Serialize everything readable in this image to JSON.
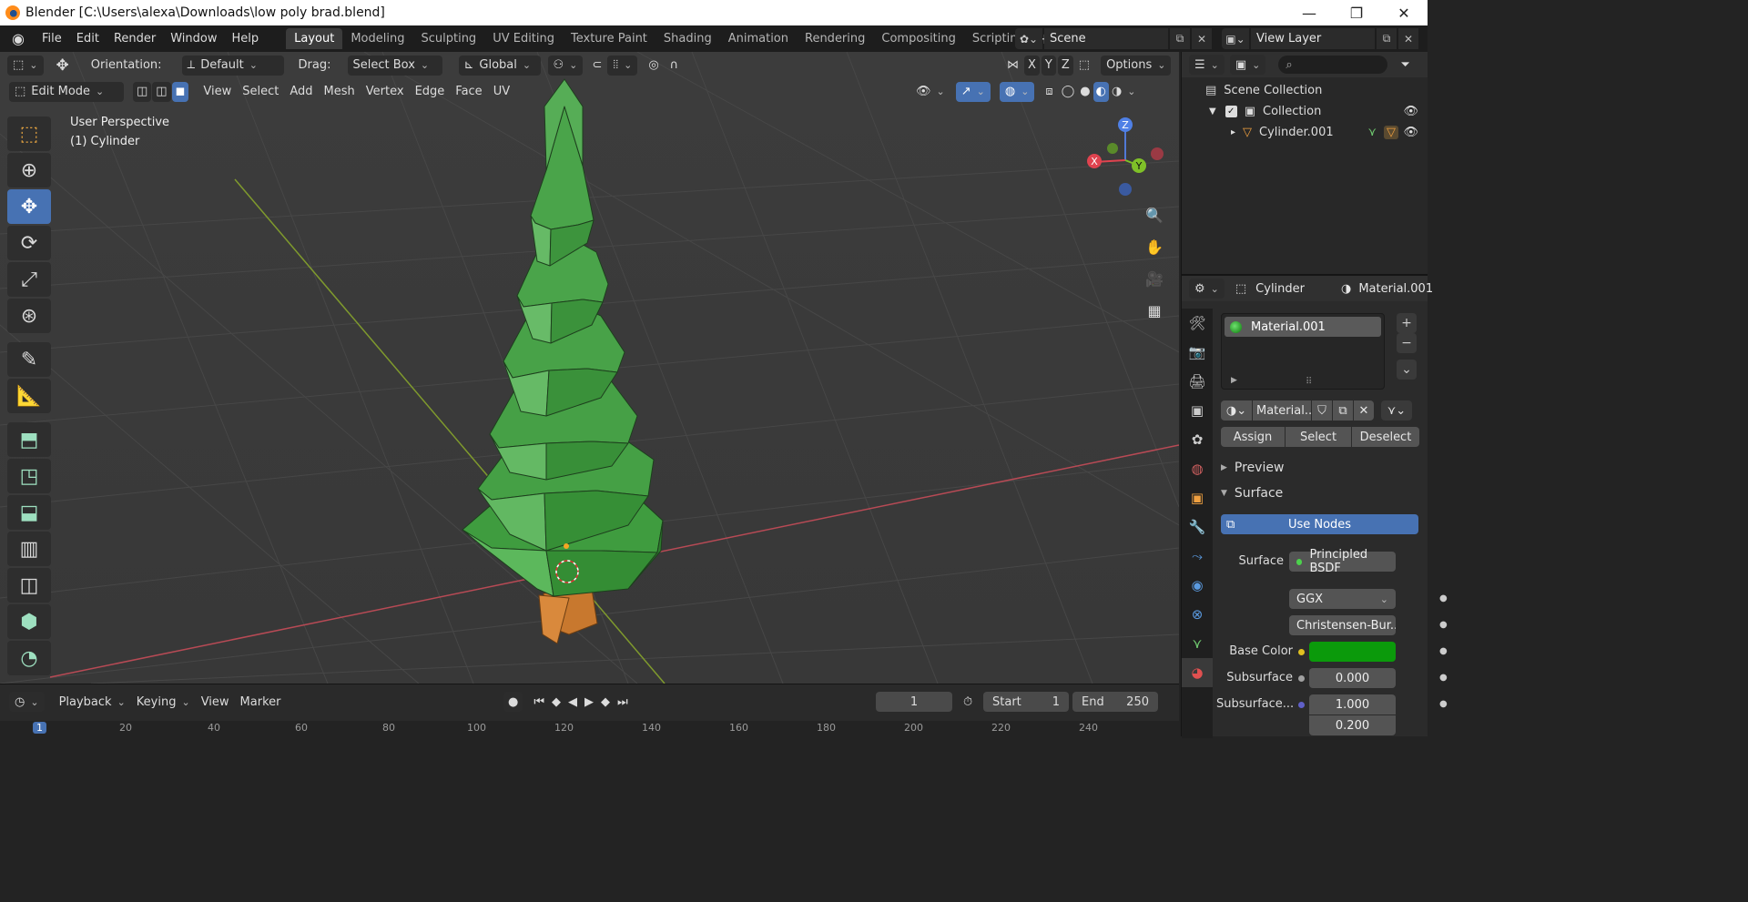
{
  "window": {
    "title": "Blender [C:\\Users\\alexa\\Downloads\\low poly brad.blend]",
    "controls": [
      "—",
      "❐",
      "✕"
    ]
  },
  "menubar": {
    "items": [
      "File",
      "Edit",
      "Render",
      "Window",
      "Help"
    ],
    "workspaces": [
      "Layout",
      "Modeling",
      "Sculpting",
      "UV Editing",
      "Texture Paint",
      "Shading",
      "Animation",
      "Rendering",
      "Compositing",
      "Scripting"
    ],
    "active_workspace": "Layout",
    "scene": "Scene",
    "view_layer": "View Layer"
  },
  "viewport_header": {
    "orientation_label": "Orientation:",
    "orientation_value": "Default",
    "drag_label": "Drag:",
    "drag_value": "Select Box",
    "transform_space": "Global",
    "axes": [
      "X",
      "Y",
      "Z"
    ],
    "options_label": "Options",
    "mode": "Edit Mode",
    "menus": [
      "View",
      "Select",
      "Add",
      "Mesh",
      "Vertex",
      "Edge",
      "Face",
      "UV"
    ]
  },
  "viewport": {
    "perspective_label": "User Perspective",
    "object_label": "(1) Cylinder",
    "gizmo_axes": [
      "X",
      "Y",
      "Z"
    ]
  },
  "timeline": {
    "menus": [
      "Playback",
      "Keying",
      "View",
      "Marker"
    ],
    "current_frame": "1",
    "start_label": "Start",
    "start_value": "1",
    "end_label": "End",
    "end_value": "250",
    "ruler_ticks": [
      "1",
      "20",
      "40",
      "60",
      "80",
      "100",
      "120",
      "140",
      "160",
      "180",
      "200",
      "220",
      "240"
    ]
  },
  "outliner": {
    "rows": [
      {
        "label": "Scene Collection"
      },
      {
        "label": "Collection"
      },
      {
        "label": "Cylinder.001"
      }
    ]
  },
  "properties": {
    "object_name": "Cylinder",
    "material_name": "Material.001",
    "slots": [
      "Material.001"
    ],
    "material_field": "Material...",
    "buttons": [
      "Assign",
      "Select",
      "Deselect"
    ],
    "panels": {
      "preview": "Preview",
      "surface": "Surface"
    },
    "use_nodes": "Use Nodes",
    "surface_label": "Surface",
    "surface_value": "Principled BSDF",
    "distribution": "GGX",
    "subsurface_method": "Christensen-Bur...",
    "base_color_label": "Base Color",
    "base_color": "#0b9a0b",
    "subsurface_label": "Subsurface",
    "subsurface_value": "0.000",
    "subsurface_radius_label": "Subsurface...",
    "subsurface_radius_values": [
      "1.000",
      "0.200"
    ]
  },
  "colors": {
    "accent": "#4772b3",
    "tree_green": "#3d9e3d",
    "trunk_orange": "#c8782e",
    "x_axis": "#c24a56",
    "y_axis": "#8ab232"
  }
}
